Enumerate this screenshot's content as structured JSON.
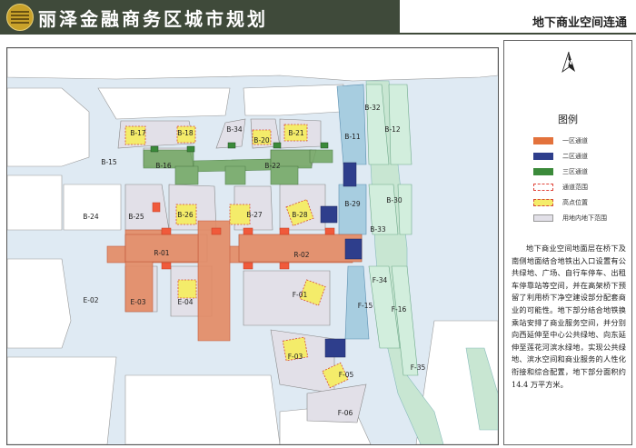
{
  "header": {
    "title": "丽泽金融商务区城市规划",
    "subtitle": "地下商业空间连通"
  },
  "legend": {
    "title": "图例",
    "items": [
      {
        "label": "一区通道",
        "color": "#e3723c"
      },
      {
        "label": "二区通道",
        "color": "#2e3e8c"
      },
      {
        "label": "三区通道",
        "color": "#3b8a3a"
      },
      {
        "label": "通道范围",
        "color": "#e0453a"
      },
      {
        "label": "高点位置",
        "color": "#f4ec6a"
      },
      {
        "label": "用地内地下范围",
        "color": "#e2e0e8"
      }
    ]
  },
  "description": "地下商业空间地面层在桥下及南侧地面结合地铁出入口设置有公共绿地、广场、自行车停车、出租车停靠站等空间，并在高架桥下预留了利用桥下净空建设部分配套商业的可能性。地下部分结合地铁换乘站安排了商业服务空间，并分别向西延伸至中心公共绿地、向东延伸至莲花河滨水绿地，实现公共绿地、滨水空间和商业服务的人性化衔接和综合配置，地下部分面积约 14.4 万平方米。",
  "map": {
    "parcels": [
      "B-17",
      "B-18",
      "B-34",
      "B-20",
      "B-21",
      "B-15",
      "B-16",
      "B-22",
      "B-11",
      "B-32",
      "B-12",
      "B-24",
      "B-25",
      "B-26",
      "B-27",
      "B-28",
      "B-29",
      "B-30",
      "B-33",
      "R-01",
      "R-02",
      "E-02",
      "E-03",
      "E-04",
      "F-01",
      "F-03",
      "F-05",
      "F-06",
      "F-15",
      "F-16",
      "F-34",
      "F-35"
    ]
  }
}
